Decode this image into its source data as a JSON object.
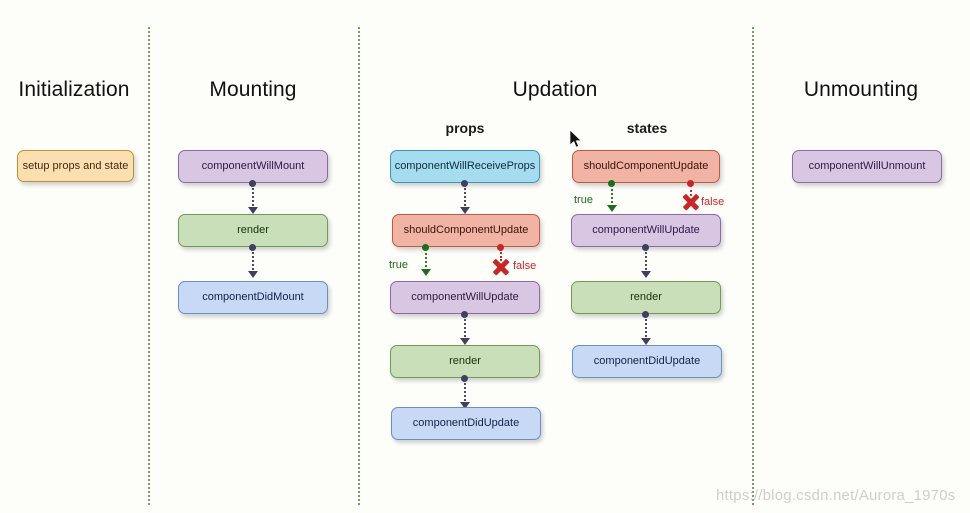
{
  "watermark": "https://blog.csdn.net/Aurora_1970s",
  "columns": [
    {
      "title": "Initialization"
    },
    {
      "title": "Mounting"
    },
    {
      "title": "Updation"
    },
    {
      "title": "Unmounting"
    }
  ],
  "subtitles": {
    "props": "props",
    "states": "states"
  },
  "initialization": {
    "nodes": [
      {
        "label": "setup props and state",
        "color": "#fbdfb0"
      }
    ]
  },
  "mounting": {
    "nodes": [
      {
        "label": "componentWillMount",
        "color": "#d8c6e3"
      },
      {
        "label": "render",
        "color": "#c9dfba"
      },
      {
        "label": "componentDidMount",
        "color": "#c7d9f4"
      }
    ]
  },
  "updation_props": {
    "nodes": [
      {
        "label": "componentWillReceiveProps",
        "color": "#a6dcef"
      },
      {
        "label": "shouldComponentUpdate",
        "color": "#f0b3a4"
      },
      {
        "label": "componentWillUpdate",
        "color": "#d8c6e3"
      },
      {
        "label": "render",
        "color": "#c9dfba"
      },
      {
        "label": "componentDidUpdate",
        "color": "#c7d9f4"
      }
    ],
    "branch_true": "true",
    "branch_false": "false"
  },
  "updation_states": {
    "nodes": [
      {
        "label": "shouldComponentUpdate",
        "color": "#f0b3a4"
      },
      {
        "label": "componentWillUpdate",
        "color": "#d8c6e3"
      },
      {
        "label": "render",
        "color": "#c9dfba"
      },
      {
        "label": "componentDidUpdate",
        "color": "#c7d9f4"
      }
    ],
    "branch_true": "true",
    "branch_false": "false"
  },
  "unmounting": {
    "nodes": [
      {
        "label": "componentWillUnmount",
        "color": "#d8c6e3"
      }
    ]
  },
  "colors": {
    "divider": "#4e7d3a",
    "true": "#1d6b1d",
    "false": "#c62828",
    "connector": "#3f3f5e",
    "background": "#fdfdfa"
  }
}
